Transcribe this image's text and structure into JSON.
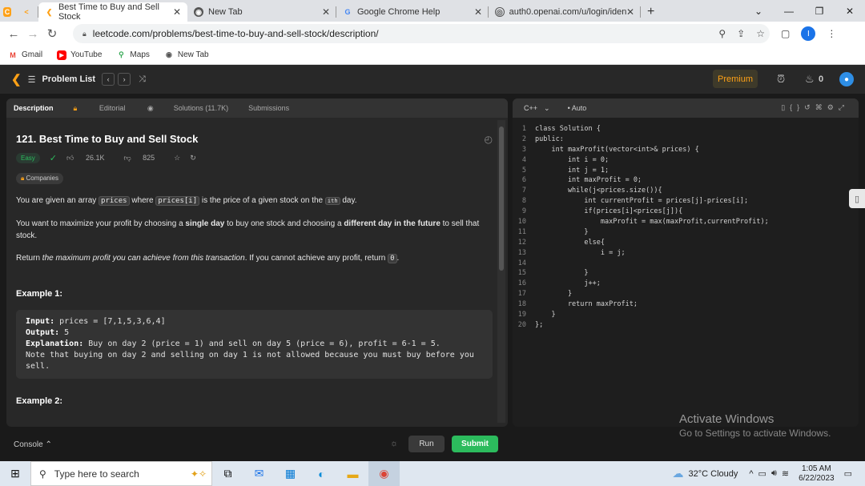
{
  "browser": {
    "tabs": [
      {
        "label": "Best Time to Buy and Sell Stock",
        "icon": "leetcode-icon"
      },
      {
        "label": "New Tab",
        "icon": "chrome-icon"
      },
      {
        "label": "Google Chrome Help",
        "icon": "google-icon"
      },
      {
        "label": "auth0.openai.com/u/login/identi",
        "icon": "globe-icon"
      }
    ],
    "url": "leetcode.com/problems/best-time-to-buy-and-sell-stock/description/",
    "profile_initial": "I",
    "bookmarks": [
      "Gmail",
      "YouTube",
      "Maps",
      "New Tab"
    ]
  },
  "header": {
    "problem_list": "Problem List",
    "premium": "Premium",
    "streak": "0"
  },
  "left_tabs": [
    "Description",
    "Editorial",
    "Solutions (11.7K)",
    "Submissions"
  ],
  "problem": {
    "title": "121. Best Time to Buy and Sell Stock",
    "difficulty": "Easy",
    "likes": "26.1K",
    "dislikes": "825",
    "companies": "Companies",
    "p1_a": "You are given an array ",
    "p1_code1": "prices",
    "p1_b": " where ",
    "p1_code2": "prices[i]",
    "p1_c": " is the price of a given stock on the ",
    "p1_sup": "ith",
    "p1_d": " day.",
    "p2_a": "You want to maximize your profit by choosing a ",
    "p2_b1": "single day",
    "p2_c": " to buy one stock and choosing a ",
    "p2_b2": "different day in the future",
    "p2_d": " to sell that stock.",
    "p3_a": "Return ",
    "p3_i": "the maximum profit you can achieve from this transaction",
    "p3_b": ". If you cannot achieve any profit, return ",
    "p3_code": "0",
    "p3_c": ".",
    "example1": "Example 1:",
    "ex1_input_label": "Input:",
    "ex1_input": " prices = [7,1,5,3,6,4]",
    "ex1_output_label": "Output:",
    "ex1_output": " 5",
    "ex1_expl_label": "Explanation:",
    "ex1_expl": " Buy on day 2 (price = 1) and sell on day 5 (price = 6), profit = 6-1 = 5.\nNote that buying on day 2 and selling on day 1 is not allowed because you must buy before you sell.",
    "example2": "Example 2:"
  },
  "editor": {
    "language": "C++",
    "mode": "Auto",
    "lines": [
      "class Solution {",
      "public:",
      "    int maxProfit(vector<int>& prices) {",
      "        int i = 0;",
      "        int j = 1;",
      "        int maxProfit = 0;",
      "        while(j<prices.size()){",
      "            int currentProfit = prices[j]-prices[i];",
      "            if(prices[i]<prices[j]){",
      "                maxProfit = max(maxProfit,currentProfit);",
      "            }",
      "            else{",
      "                i = j;",
      "",
      "            }",
      "            j++;",
      "        }",
      "        return maxProfit;",
      "    }",
      "};"
    ]
  },
  "watermark": {
    "line1": "Activate Windows",
    "line2": "Go to Settings to activate Windows."
  },
  "bottom": {
    "console": "Console",
    "run": "Run",
    "submit": "Submit"
  },
  "taskbar": {
    "search_placeholder": "Type here to search",
    "weather": "32°C  Cloudy",
    "time": "1:05 AM",
    "date": "6/22/2023"
  }
}
